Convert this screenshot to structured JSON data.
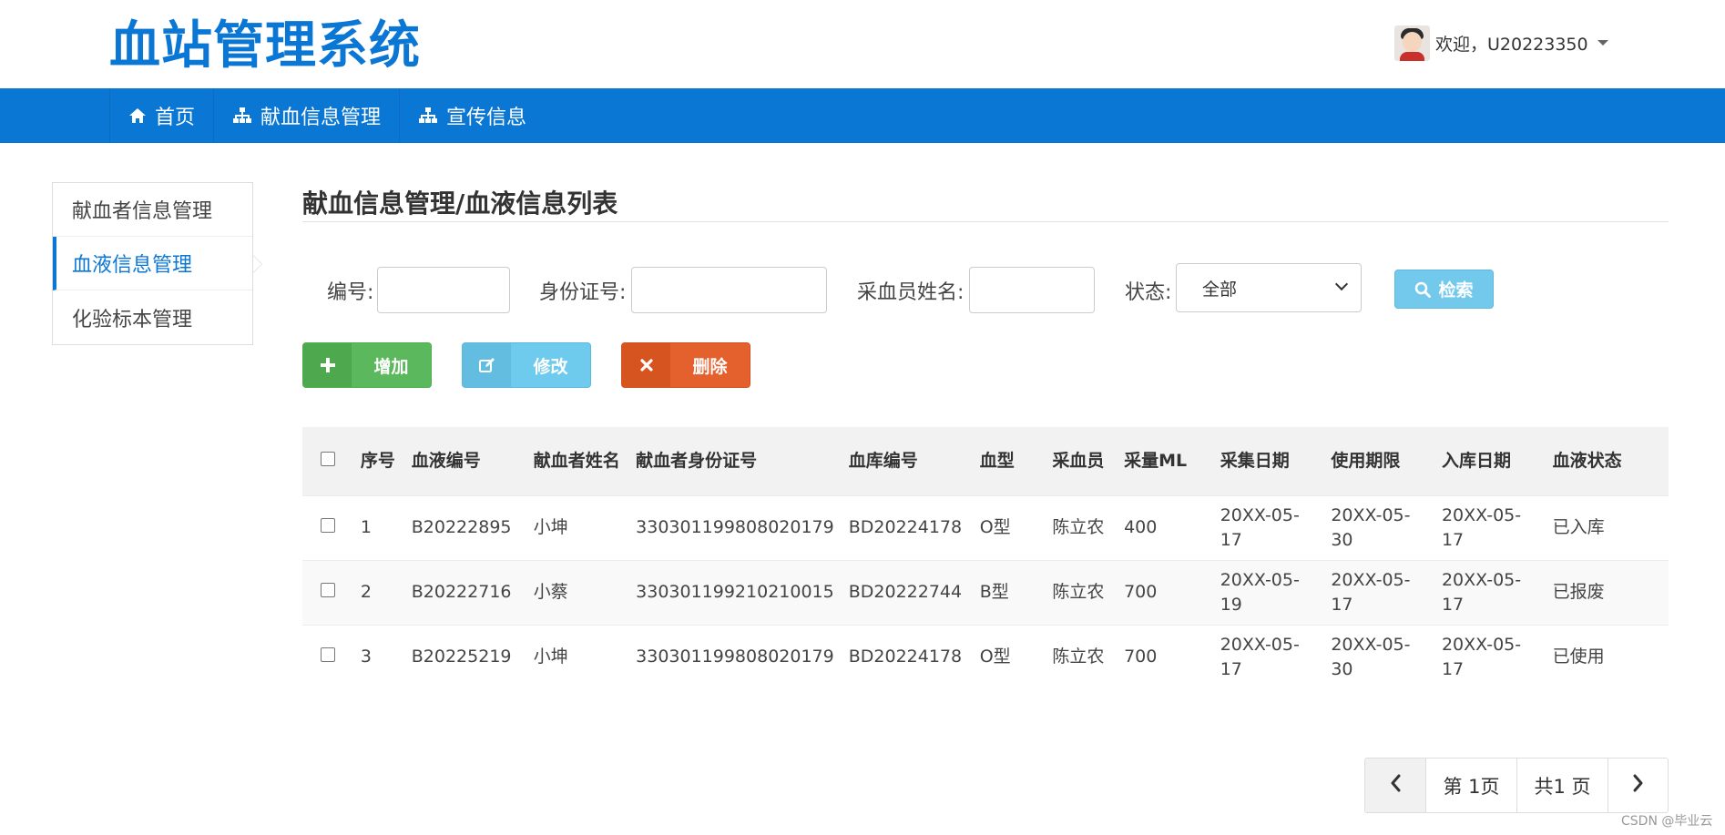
{
  "header": {
    "app_title": "血站管理系统",
    "welcome_text": "欢迎，U20223350"
  },
  "nav": {
    "items": [
      {
        "label": "首页",
        "icon": "home-icon"
      },
      {
        "label": "献血信息管理",
        "icon": "sitemap-icon"
      },
      {
        "label": "宣传信息",
        "icon": "sitemap-icon"
      }
    ]
  },
  "sidebar": {
    "items": [
      {
        "label": "献血者信息管理",
        "active": false
      },
      {
        "label": "血液信息管理",
        "active": true
      },
      {
        "label": "化验标本管理",
        "active": false
      }
    ]
  },
  "main": {
    "title": "献血信息管理/血液信息列表"
  },
  "search": {
    "id_label": "编号:",
    "id_value": "",
    "idcard_label": "身份证号:",
    "idcard_value": "",
    "collector_label": "采血员姓名:",
    "collector_value": "",
    "status_label": "状态:",
    "status_selected": "全部",
    "search_button": "检索"
  },
  "actions": {
    "add": "增加",
    "edit": "修改",
    "delete": "删除"
  },
  "table": {
    "headers": [
      "序号",
      "血液编号",
      "献血者姓名",
      "献血者身份证号",
      "血库编号",
      "血型",
      "采血员",
      "采量ML",
      "采集日期",
      "使用期限",
      "入库日期",
      "血液状态"
    ],
    "rows": [
      [
        "1",
        "B20222895",
        "小坤",
        "330301199808020179",
        "BD20224178",
        "O型",
        "陈立农",
        "400",
        "20XX-05-17",
        "20XX-05-30",
        "20XX-05-17",
        "已入库"
      ],
      [
        "2",
        "B20222716",
        "小蔡",
        "330301199210210015",
        "BD20222744",
        "B型",
        "陈立农",
        "700",
        "20XX-05-19",
        "20XX-05-17",
        "20XX-05-17",
        "已报废"
      ],
      [
        "3",
        "B20225219",
        "小坤",
        "330301199808020179",
        "BD20224178",
        "O型",
        "陈立农",
        "700",
        "20XX-05-17",
        "20XX-05-30",
        "20XX-05-17",
        "已使用"
      ]
    ]
  },
  "pager": {
    "current": "第 1页",
    "total": "共1 页"
  },
  "watermark": "CSDN @毕业云",
  "colors": {
    "brand": "#0a77d5",
    "add": "#5cb85c",
    "edit": "#6fcbee",
    "delete": "#e4602d",
    "search": "#73c9ec"
  }
}
